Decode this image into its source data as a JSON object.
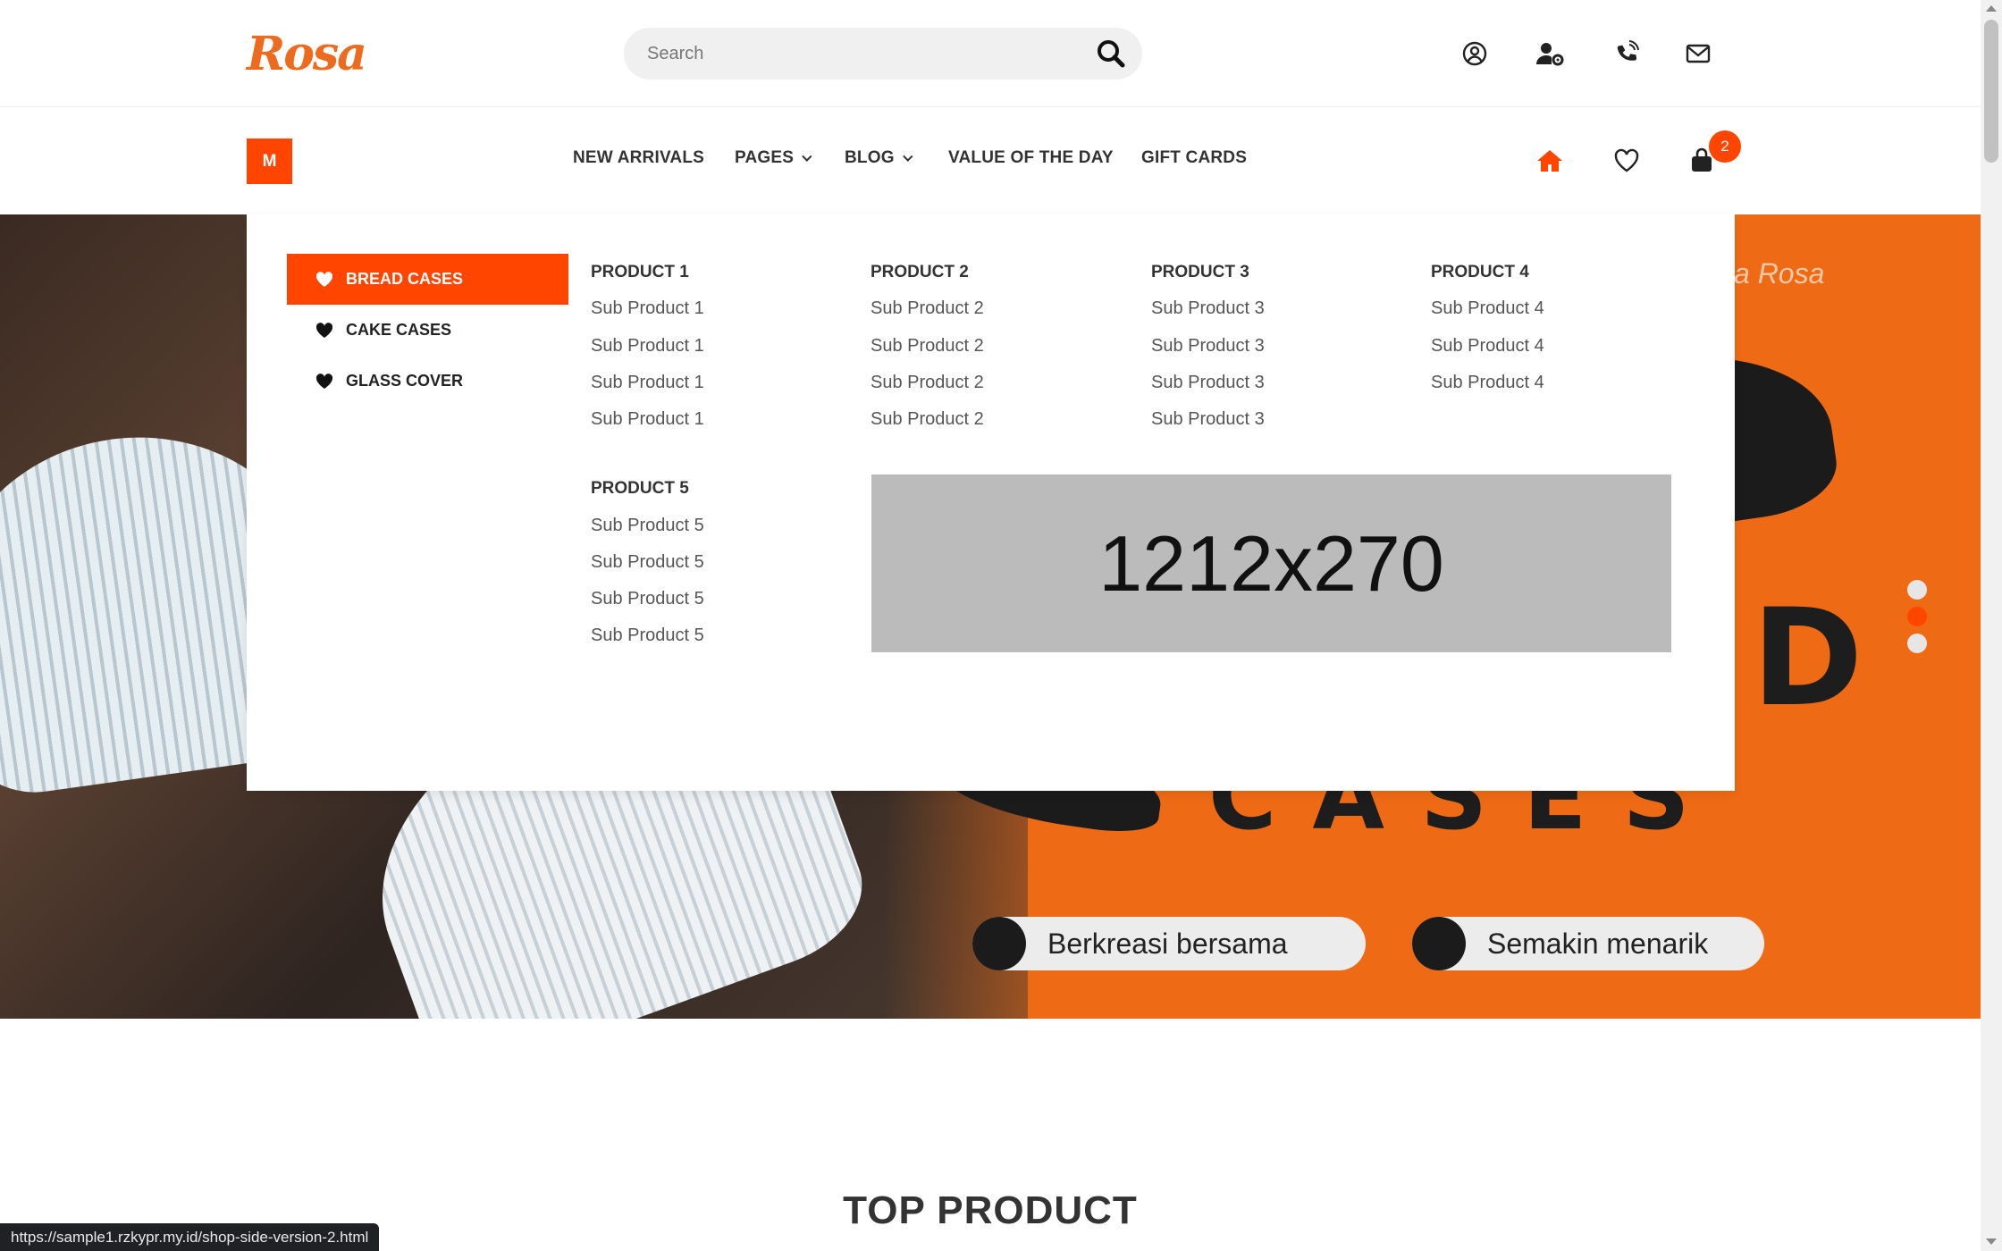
{
  "brand": {
    "logo_text": "Rosa",
    "accent": "#ff4500"
  },
  "search": {
    "placeholder": "Search"
  },
  "header_icons": [
    "account-icon",
    "user-settings-icon",
    "phone-icon",
    "mail-icon"
  ],
  "menu_button": {
    "label": "M"
  },
  "nav": {
    "items": [
      {
        "label": "NEW ARRIVALS",
        "has_dropdown": false
      },
      {
        "label": "PAGES",
        "has_dropdown": true
      },
      {
        "label": "BLOG",
        "has_dropdown": true
      },
      {
        "label": "VALUE OF THE DAY",
        "has_dropdown": false
      },
      {
        "label": "GIFT CARDS",
        "has_dropdown": false
      }
    ],
    "cart_count": "2"
  },
  "mega_menu": {
    "categories": [
      {
        "label": "BREAD CASES",
        "active": true
      },
      {
        "label": "CAKE CASES",
        "active": false
      },
      {
        "label": "GLASS COVER",
        "active": false
      }
    ],
    "columns": [
      {
        "title": "PRODUCT 1",
        "items": [
          "Sub Product 1",
          "Sub Product 1",
          "Sub Product 1",
          "Sub Product 1"
        ]
      },
      {
        "title": "PRODUCT 2",
        "items": [
          "Sub Product 2",
          "Sub Product 2",
          "Sub Product 2",
          "Sub Product 2"
        ]
      },
      {
        "title": "PRODUCT 3",
        "items": [
          "Sub Product 3",
          "Sub Product 3",
          "Sub Product 3",
          "Sub Product 3"
        ]
      },
      {
        "title": "PRODUCT 4",
        "items": [
          "Sub Product 4",
          "Sub Product 4",
          "Sub Product 4"
        ]
      },
      {
        "title": "PRODUCT 5",
        "items": [
          "Sub Product 5",
          "Sub Product 5",
          "Sub Product 5",
          "Sub Product 5"
        ]
      }
    ],
    "banner_text": "1212x270"
  },
  "hero": {
    "tagline": "a Rosa",
    "big_letter": "D",
    "big_word": "C A S E S",
    "pills": [
      "Berkreasi bersama",
      "Semakin menarik"
    ],
    "active_slide": 2
  },
  "section_title": "TOP PRODUCT",
  "status_url": "https://sample1.rzkypr.my.id/shop-side-version-2.html"
}
